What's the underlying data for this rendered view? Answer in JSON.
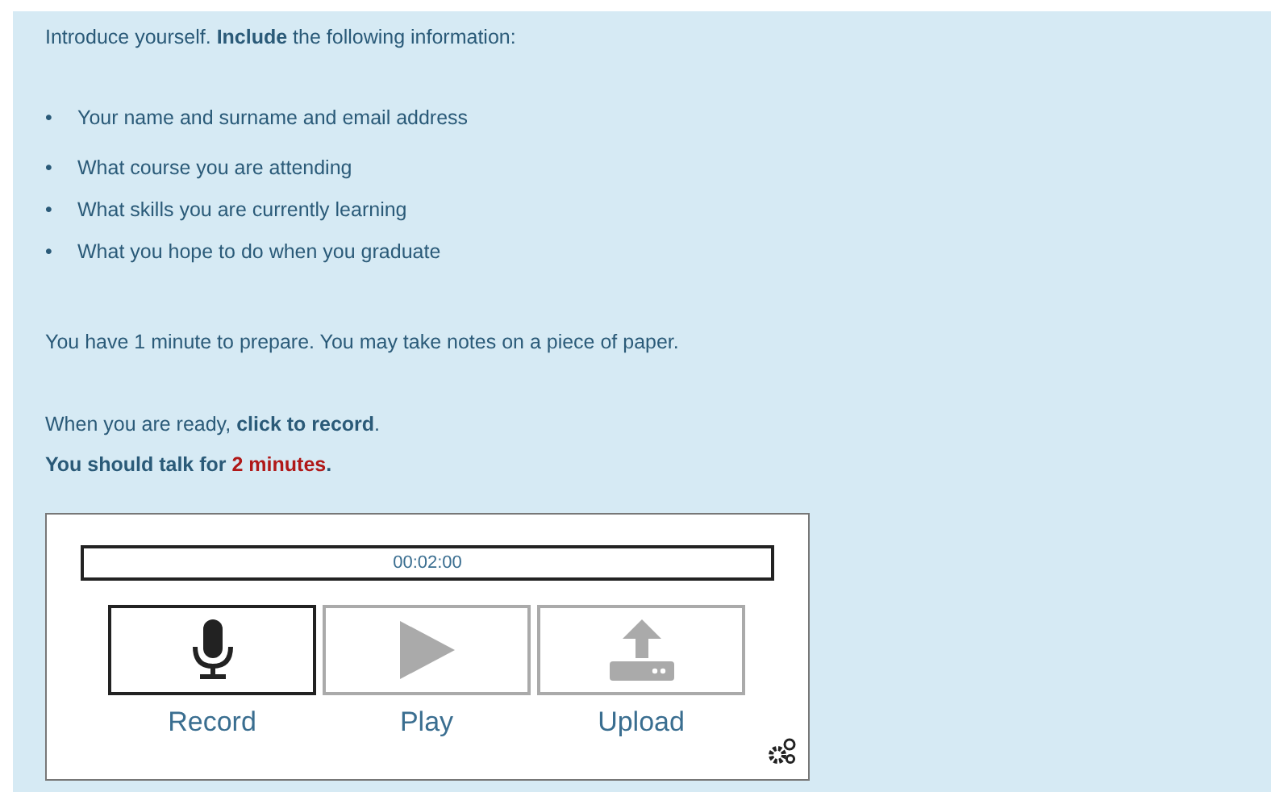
{
  "intro": "Introduce yourself. **Include** the following information:",
  "bullets": [
    {
      "marker": "•",
      "text": "Your name and surname and email address"
    },
    {
      "marker": "•",
      "text": "What course you are attending"
    },
    {
      "marker": "•",
      "text": "What skills you are currently learning"
    },
    {
      "marker": "•",
      "text": "What you hope to do when you graduate"
    }
  ],
  "prepare": "You have 1 minute to prepare. You may take notes on a piece of paper.",
  "ready": "When you are ready, **click to record**.",
  "talk": {
    "text": "You should talk for ",
    "highlight": "2 minutes",
    "end": "."
  },
  "recorder": {
    "timer": "00:02:00",
    "buttons": [
      {
        "kind": "record",
        "label": "Record",
        "disabled": false
      },
      {
        "kind": "play",
        "label": "Play",
        "disabled": true
      },
      {
        "kind": "upload",
        "label": "Upload",
        "disabled": true
      }
    ]
  }
}
